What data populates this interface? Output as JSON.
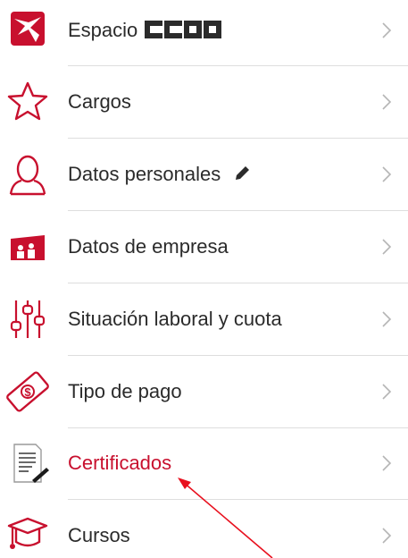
{
  "menu": {
    "items": [
      {
        "label": "Espacio",
        "brand_text": "CCOO",
        "icon": "ccoo-logo-icon"
      },
      {
        "label": "Cargos",
        "icon": "star-icon"
      },
      {
        "label": "Datos personales",
        "icon": "person-icon",
        "edit_icon": "pencil-icon"
      },
      {
        "label": "Datos de empresa",
        "icon": "company-icon"
      },
      {
        "label": "Situación laboral y cuota",
        "icon": "sliders-icon"
      },
      {
        "label": "Tipo de pago",
        "icon": "money-icon"
      },
      {
        "label": "Certificados",
        "icon": "certificate-document-icon",
        "highlighted": true
      },
      {
        "label": "Cursos",
        "icon": "graduation-cap-icon"
      }
    ],
    "chevron_icon": "chevron-right-icon"
  },
  "colors": {
    "brand_red": "#c8102e",
    "text": "#2b2b2b",
    "chevron": "#b5b5b5",
    "separator": "#dedede",
    "annotation_arrow": "#e8101e"
  },
  "annotation": {
    "icon": "pointer-arrow"
  }
}
